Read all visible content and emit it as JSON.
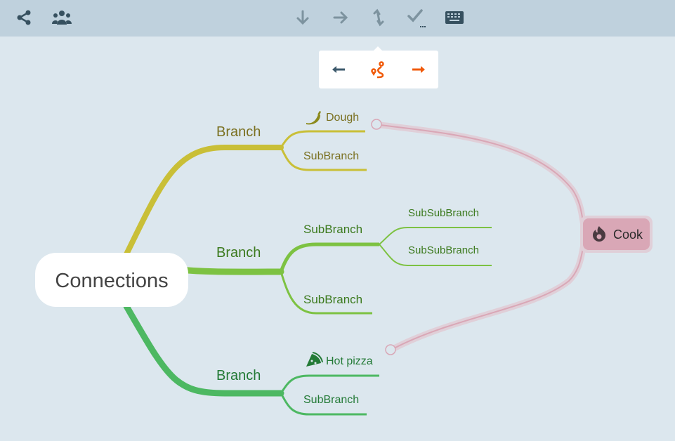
{
  "toolbar": {
    "left_icons": [
      "share-icon",
      "users-icon"
    ],
    "center_icons": [
      "arrow-down-icon",
      "arrow-right-icon",
      "arrows-vertical-icon",
      "check-more-icon",
      "keyboard-icon"
    ]
  },
  "popup": {
    "icons": [
      "arrow-left-icon",
      "route-icon",
      "arrow-right-icon"
    ],
    "colors": {
      "left": "#3d5a6c",
      "accent": "#f05a0a"
    }
  },
  "mindmap": {
    "root": "Connections",
    "branches": [
      {
        "label": "Branch",
        "color": "#c9bf37",
        "text_color": "#7a7020",
        "children": [
          {
            "label": "Dough",
            "icon": "chili-pepper-icon"
          },
          {
            "label": "SubBranch"
          }
        ]
      },
      {
        "label": "Branch",
        "color": "#7dc242",
        "text_color": "#3c7a1e",
        "children": [
          {
            "label": "SubBranch",
            "children": [
              {
                "label": "SubSubBranch"
              },
              {
                "label": "SubSubBranch"
              }
            ]
          },
          {
            "label": "SubBranch"
          }
        ]
      },
      {
        "label": "Branch",
        "color": "#4db862",
        "text_color": "#237a36",
        "children": [
          {
            "label": "Hot pizza",
            "icon": "pizza-icon"
          },
          {
            "label": "SubBranch"
          }
        ]
      }
    ],
    "connection": {
      "label": "Cook",
      "icon": "fire-icon",
      "color": "#d9a7b6"
    }
  }
}
